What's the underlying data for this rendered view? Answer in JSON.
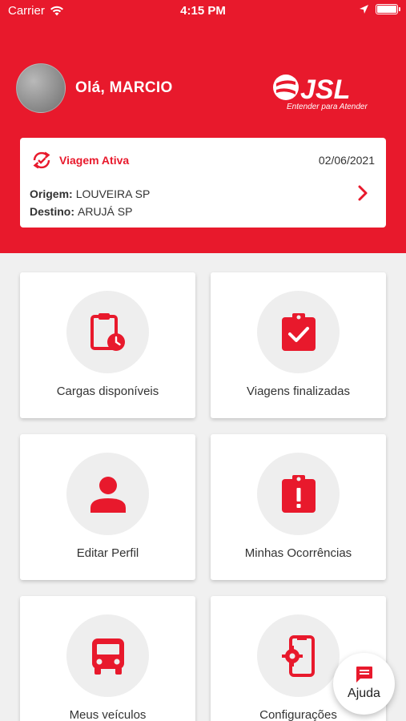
{
  "status_bar": {
    "carrier": "Carrier",
    "time": "4:15 PM"
  },
  "header": {
    "greeting": "Olá, MARCIO",
    "logo_text": "JSL",
    "logo_tagline": "Entender para Atender"
  },
  "trip": {
    "title": "Viagem Ativa",
    "date": "02/06/2021",
    "origin_label": "Origem:",
    "origin_value": "LOUVEIRA SP",
    "destination_label": "Destino:",
    "destination_value": "ARUJÁ SP"
  },
  "menu": [
    {
      "label": "Cargas disponíveis",
      "icon": "clipboard-clock-icon"
    },
    {
      "label": "Viagens finalizadas",
      "icon": "clipboard-check-icon"
    },
    {
      "label": "Editar Perfil",
      "icon": "person-icon"
    },
    {
      "label": "Minhas Ocorrências",
      "icon": "clipboard-alert-icon"
    },
    {
      "label": "Meus veículos",
      "icon": "bus-icon"
    },
    {
      "label": "Configurações",
      "icon": "phone-settings-icon"
    }
  ],
  "help": {
    "label": "Ajuda",
    "icon": "chat-icon"
  },
  "colors": {
    "brand": "#e8192c",
    "background": "#f0f0f0",
    "circle": "#eeeeee"
  }
}
